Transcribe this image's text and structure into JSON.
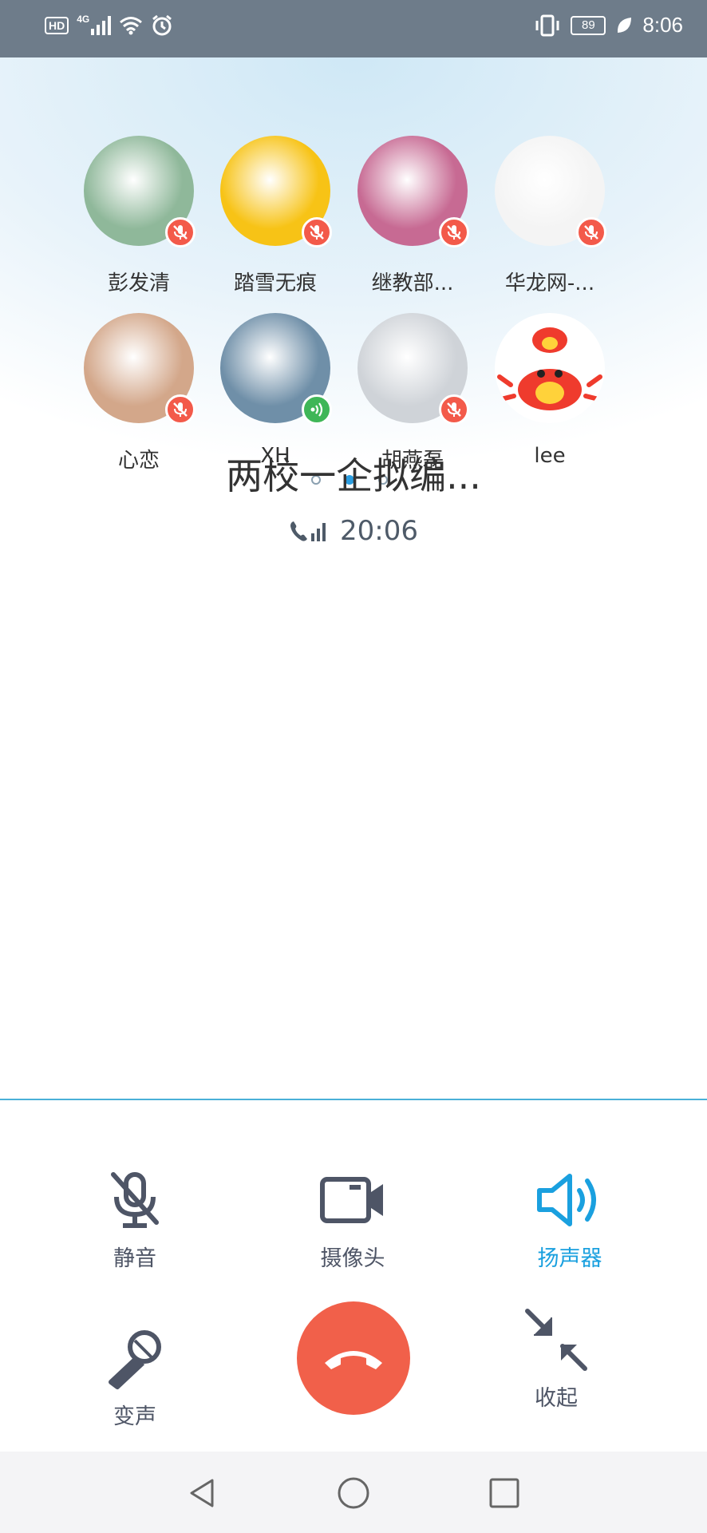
{
  "status_bar": {
    "hd": "HD",
    "network": "4G",
    "battery": "89",
    "time": "8:06"
  },
  "participants": [
    {
      "name": "彭发清",
      "mic": "muted",
      "avatar_color": "#8fb89a"
    },
    {
      "name": "踏雪无痕",
      "mic": "muted",
      "avatar_color": "#f7c316"
    },
    {
      "name": "继教部...",
      "mic": "muted",
      "avatar_color": "#c76a93"
    },
    {
      "name": "华龙网-...",
      "mic": "muted",
      "avatar_color": "#f4f4f4"
    },
    {
      "name": "心恋",
      "mic": "muted",
      "avatar_color": "#d3a78a"
    },
    {
      "name": "XH",
      "mic": "talking",
      "avatar_color": "#6f8fa8"
    },
    {
      "name": "胡燕磊",
      "mic": "muted",
      "avatar_color": "#cfd3d8"
    },
    {
      "name": "lee",
      "mic": "none",
      "avatar_color": "#ffffff"
    }
  ],
  "call": {
    "group_title": "两校一企拟编...",
    "duration": "20:06",
    "page_indicator": {
      "pages": 3,
      "active": 2
    }
  },
  "controls": {
    "mute": "静音",
    "camera": "摄像头",
    "speaker": "扬声器",
    "voice_change": "变声",
    "collapse": "收起"
  },
  "colors": {
    "accent": "#1aa0df",
    "hangup": "#f1604a",
    "muted_badge": "#f35a4a",
    "talking_badge": "#3fb657"
  }
}
